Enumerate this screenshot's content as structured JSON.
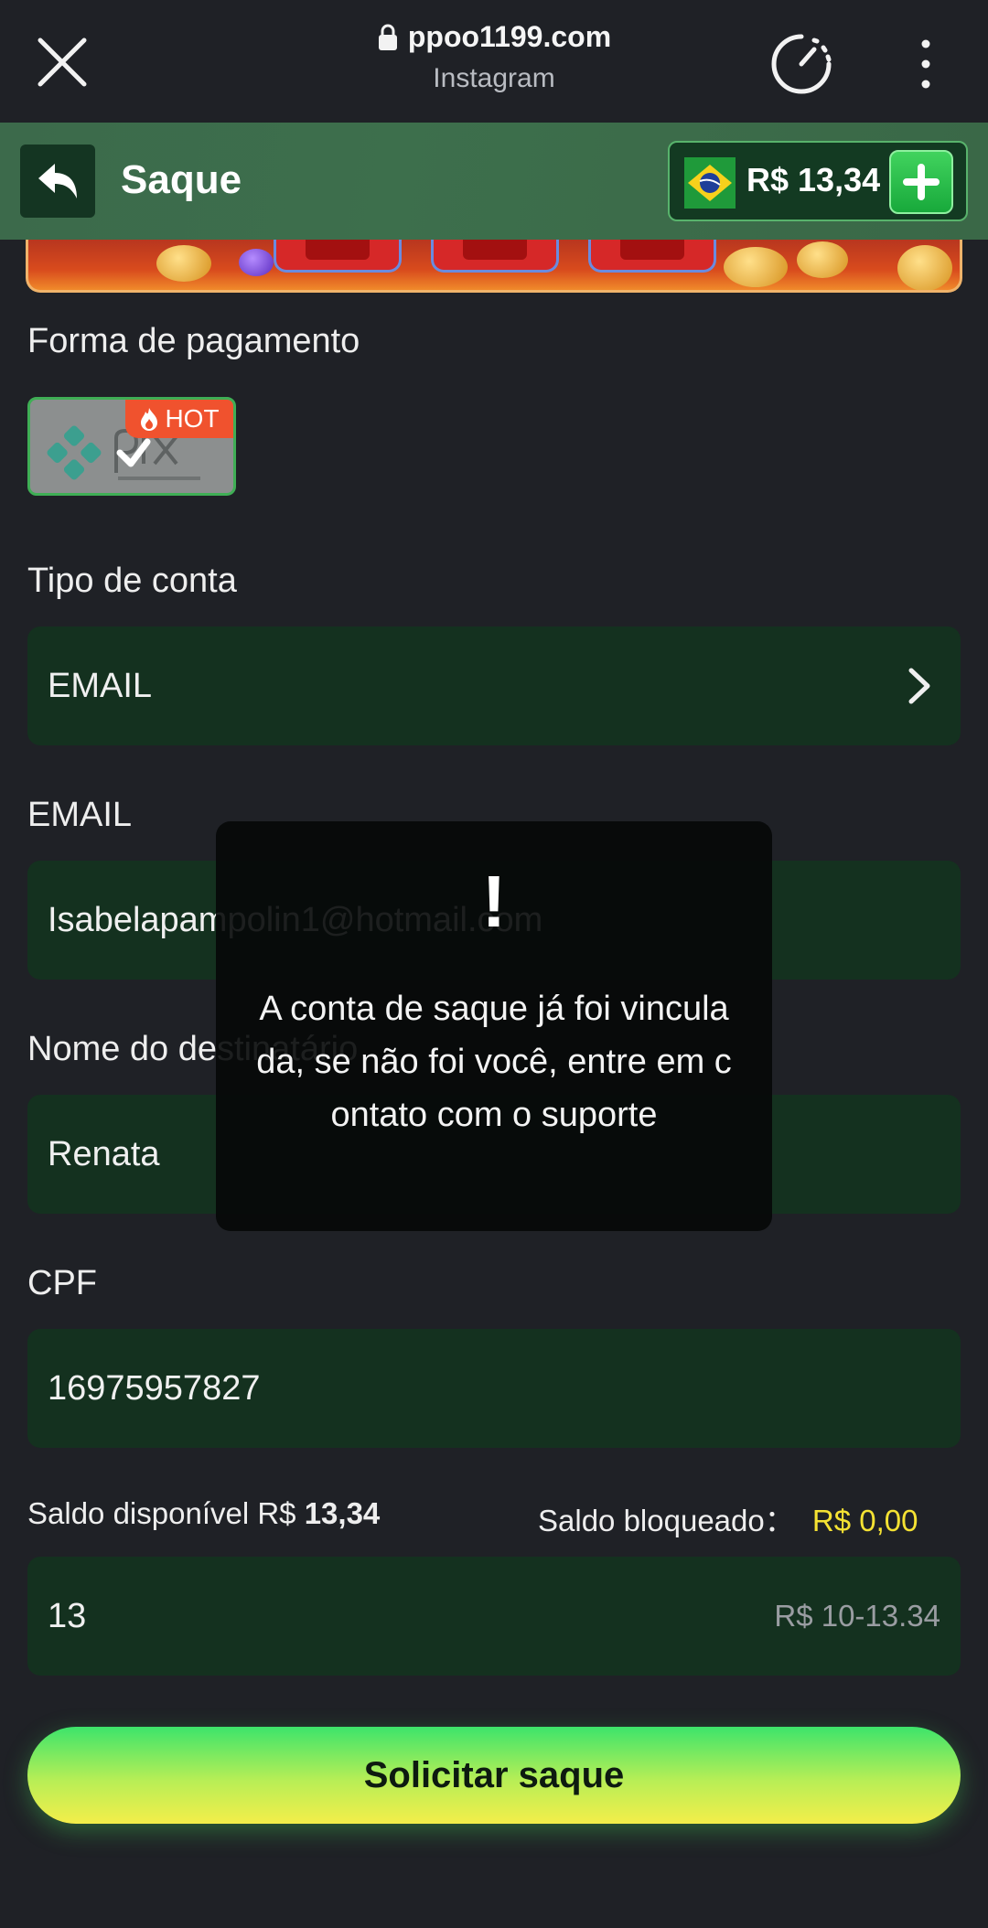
{
  "browser": {
    "url": "ppoo1199.com",
    "source": "Instagram"
  },
  "header": {
    "title": "Saque",
    "balance": "R$ 13,34"
  },
  "form": {
    "payment_label": "Forma de pagamento",
    "payment_method": {
      "badge": "HOT"
    },
    "account_type_label": "Tipo de conta",
    "account_type_value": "EMAIL",
    "email_label": "EMAIL",
    "email_value": "Isabelapampolin1@hotmail.com",
    "name_label": "Nome do destinatário",
    "name_value": "Renata",
    "cpf_label": "CPF",
    "cpf_value": "16975957827",
    "available_label": "Saldo disponível R$",
    "available_value": "13,34",
    "blocked_label": "Saldo bloqueado：",
    "blocked_value": "R$ 0,00",
    "amount_value": "13",
    "amount_range": "R$ 10-13.34",
    "submit_label": "Solicitar saque"
  },
  "toast": {
    "icon": "!",
    "message": "A conta de saque já foi vinculada, se não foi você, entre em contato com o suporte"
  },
  "colors": {
    "field_bg": "#14311f",
    "accent_green": "#3de46b",
    "accent_yellow": "#f5e233",
    "hot_badge": "#f0522e"
  }
}
